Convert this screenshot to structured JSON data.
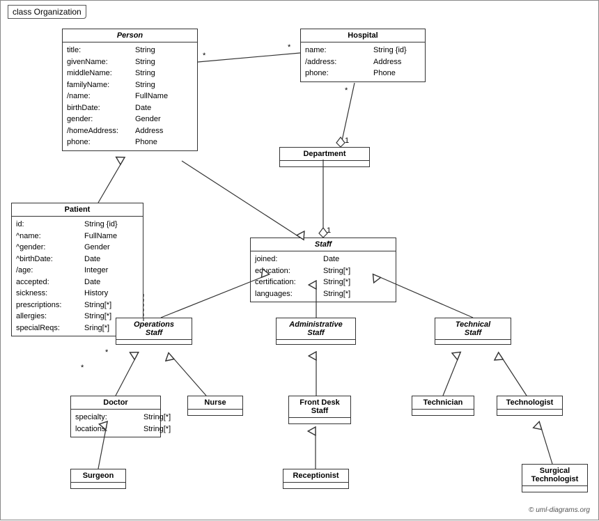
{
  "diagram": {
    "title": "class Organization",
    "classes": {
      "person": {
        "name": "Person",
        "italic": true,
        "attrs": [
          {
            "name": "title:",
            "type": "String"
          },
          {
            "name": "givenName:",
            "type": "String"
          },
          {
            "name": "middleName:",
            "type": "String"
          },
          {
            "name": "familyName:",
            "type": "String"
          },
          {
            "name": "/name:",
            "type": "FullName"
          },
          {
            "name": "birthDate:",
            "type": "Date"
          },
          {
            "name": "gender:",
            "type": "Gender"
          },
          {
            "name": "/homeAddress:",
            "type": "Address"
          },
          {
            "name": "phone:",
            "type": "Phone"
          }
        ]
      },
      "hospital": {
        "name": "Hospital",
        "italic": false,
        "attrs": [
          {
            "name": "name:",
            "type": "String {id}"
          },
          {
            "name": "/address:",
            "type": "Address"
          },
          {
            "name": "phone:",
            "type": "Phone"
          }
        ]
      },
      "patient": {
        "name": "Patient",
        "italic": false,
        "attrs": [
          {
            "name": "id:",
            "type": "String {id}"
          },
          {
            "name": "^name:",
            "type": "FullName"
          },
          {
            "name": "^gender:",
            "type": "Gender"
          },
          {
            "name": "^birthDate:",
            "type": "Date"
          },
          {
            "name": "/age:",
            "type": "Integer"
          },
          {
            "name": "accepted:",
            "type": "Date"
          },
          {
            "name": "sickness:",
            "type": "History"
          },
          {
            "name": "prescriptions:",
            "type": "String[*]"
          },
          {
            "name": "allergies:",
            "type": "String[*]"
          },
          {
            "name": "specialReqs:",
            "type": "Sring[*]"
          }
        ]
      },
      "department": {
        "name": "Department",
        "italic": false,
        "attrs": []
      },
      "staff": {
        "name": "Staff",
        "italic": true,
        "attrs": [
          {
            "name": "joined:",
            "type": "Date"
          },
          {
            "name": "education:",
            "type": "String[*]"
          },
          {
            "name": "certification:",
            "type": "String[*]"
          },
          {
            "name": "languages:",
            "type": "String[*]"
          }
        ]
      },
      "operations_staff": {
        "name": "Operations\nStaff",
        "italic": true,
        "attrs": []
      },
      "administrative_staff": {
        "name": "Administrative\nStaff",
        "italic": true,
        "attrs": []
      },
      "technical_staff": {
        "name": "Technical\nStaff",
        "italic": true,
        "attrs": []
      },
      "doctor": {
        "name": "Doctor",
        "italic": false,
        "attrs": [
          {
            "name": "specialty:",
            "type": "String[*]"
          },
          {
            "name": "locations:",
            "type": "String[*]"
          }
        ]
      },
      "nurse": {
        "name": "Nurse",
        "italic": false,
        "attrs": []
      },
      "front_desk_staff": {
        "name": "Front Desk\nStaff",
        "italic": false,
        "attrs": []
      },
      "technician": {
        "name": "Technician",
        "italic": false,
        "attrs": []
      },
      "technologist": {
        "name": "Technologist",
        "italic": false,
        "attrs": []
      },
      "surgeon": {
        "name": "Surgeon",
        "italic": false,
        "attrs": []
      },
      "receptionist": {
        "name": "Receptionist",
        "italic": false,
        "attrs": []
      },
      "surgical_technologist": {
        "name": "Surgical\nTechnologist",
        "italic": false,
        "attrs": []
      }
    },
    "copyright": "© uml-diagrams.org"
  }
}
